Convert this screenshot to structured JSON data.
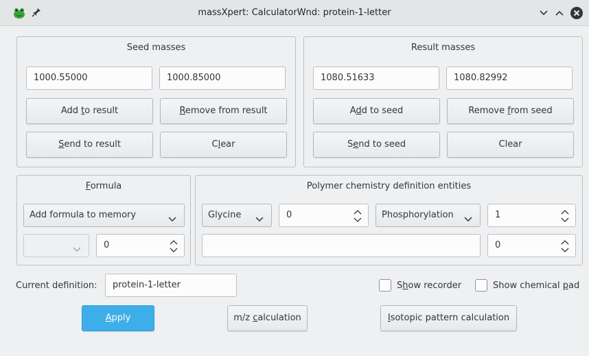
{
  "window": {
    "title": "massXpert: CalculatorWnd: protein-1-letter",
    "app_icon": "frog-icon",
    "pin_icon": "pin-icon",
    "controls": [
      "chevron-down-icon",
      "chevron-up-icon",
      "close-icon"
    ]
  },
  "seed": {
    "title": "Seed masses",
    "mono": "1000.55000",
    "avg": "1000.85000",
    "add_to_result": {
      "pre": "Add ",
      "m": "t",
      "post": "o result"
    },
    "remove_from_result": {
      "pre": "",
      "m": "R",
      "post": "emove from result"
    },
    "send_to_result": {
      "pre": "",
      "m": "S",
      "post": "end to result"
    },
    "clear": {
      "pre": "C",
      "m": "l",
      "post": "ear"
    }
  },
  "result": {
    "title": "Result masses",
    "mono": "1080.51633",
    "avg": "1080.82992",
    "add_to_seed": {
      "pre": "A",
      "m": "d",
      "post": "d to seed"
    },
    "remove_from_seed": {
      "pre": "Remove ",
      "m": "f",
      "post": "rom seed"
    },
    "send_to_seed": {
      "pre": "S",
      "m": "e",
      "post": "nd to seed"
    },
    "clear": "Clear"
  },
  "formula": {
    "title": {
      "pre": "",
      "m": "F",
      "post": "ormula"
    },
    "action_combo": "Add formula to memory",
    "formula_combo": "",
    "count": "0"
  },
  "polchem": {
    "title": "Polymer chemistry definition entities",
    "monomer": "Glycine",
    "monomer_count": "0",
    "modif": "Phosphorylation",
    "modif_count": "1",
    "sequence": "",
    "sequence_count": "0"
  },
  "definition": {
    "label": "Current definition:",
    "value": "protein-1-letter"
  },
  "options": {
    "show_recorder": {
      "pre": "S",
      "m": "h",
      "post": "ow recorder",
      "checked": false
    },
    "show_chem_pad": {
      "pre": "Show chemical ",
      "m": "p",
      "post": "ad",
      "checked": false
    }
  },
  "actions": {
    "apply": {
      "pre": "",
      "m": "A",
      "post": "pply"
    },
    "mz_calc": {
      "pre": "m/z ",
      "m": "c",
      "post": "alculation"
    },
    "isotopic": {
      "pre": "",
      "m": "I",
      "post": "sotopic pattern calculation"
    }
  },
  "colors": {
    "accent": "#3daee9",
    "window_bg": "#eff0f1",
    "titlebar_bg": "#e3e5e7"
  }
}
